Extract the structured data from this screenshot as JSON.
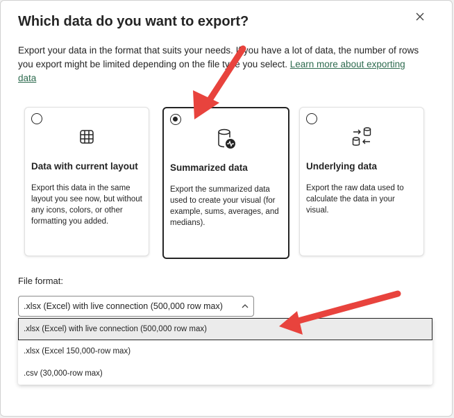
{
  "dialog": {
    "title": "Which data do you want to export?",
    "description": "Export your data in the format that suits your needs. If you have a lot of data, the number of rows you export might be limited depending on the file type you select.",
    "learn_more_link": "Learn more about exporting data"
  },
  "options": [
    {
      "title": "Data with current layout",
      "description": "Export this data in the same layout you see now, but without any icons, colors, or other formatting you added.",
      "icon": "table-grid-icon",
      "selected": false
    },
    {
      "title": "Summarized data",
      "description": "Export the summarized data used to create your visual (for example, sums, averages, and medians).",
      "icon": "database-pulse-icon",
      "selected": true
    },
    {
      "title": "Underlying data",
      "description": "Export the raw data used to calculate the data in your visual.",
      "icon": "database-sync-icon",
      "selected": false
    }
  ],
  "file_format": {
    "label": "File format:",
    "current_value": ".xlsx (Excel) with live connection (500,000 row max)",
    "options": [
      ".xlsx (Excel) with live connection (500,000 row max)",
      ".xlsx (Excel 150,000-row max)",
      ".csv (30,000-row max)"
    ]
  },
  "colors": {
    "annotation_arrow": "#e8433d",
    "link": "#2e6b4f",
    "text": "#242424"
  }
}
